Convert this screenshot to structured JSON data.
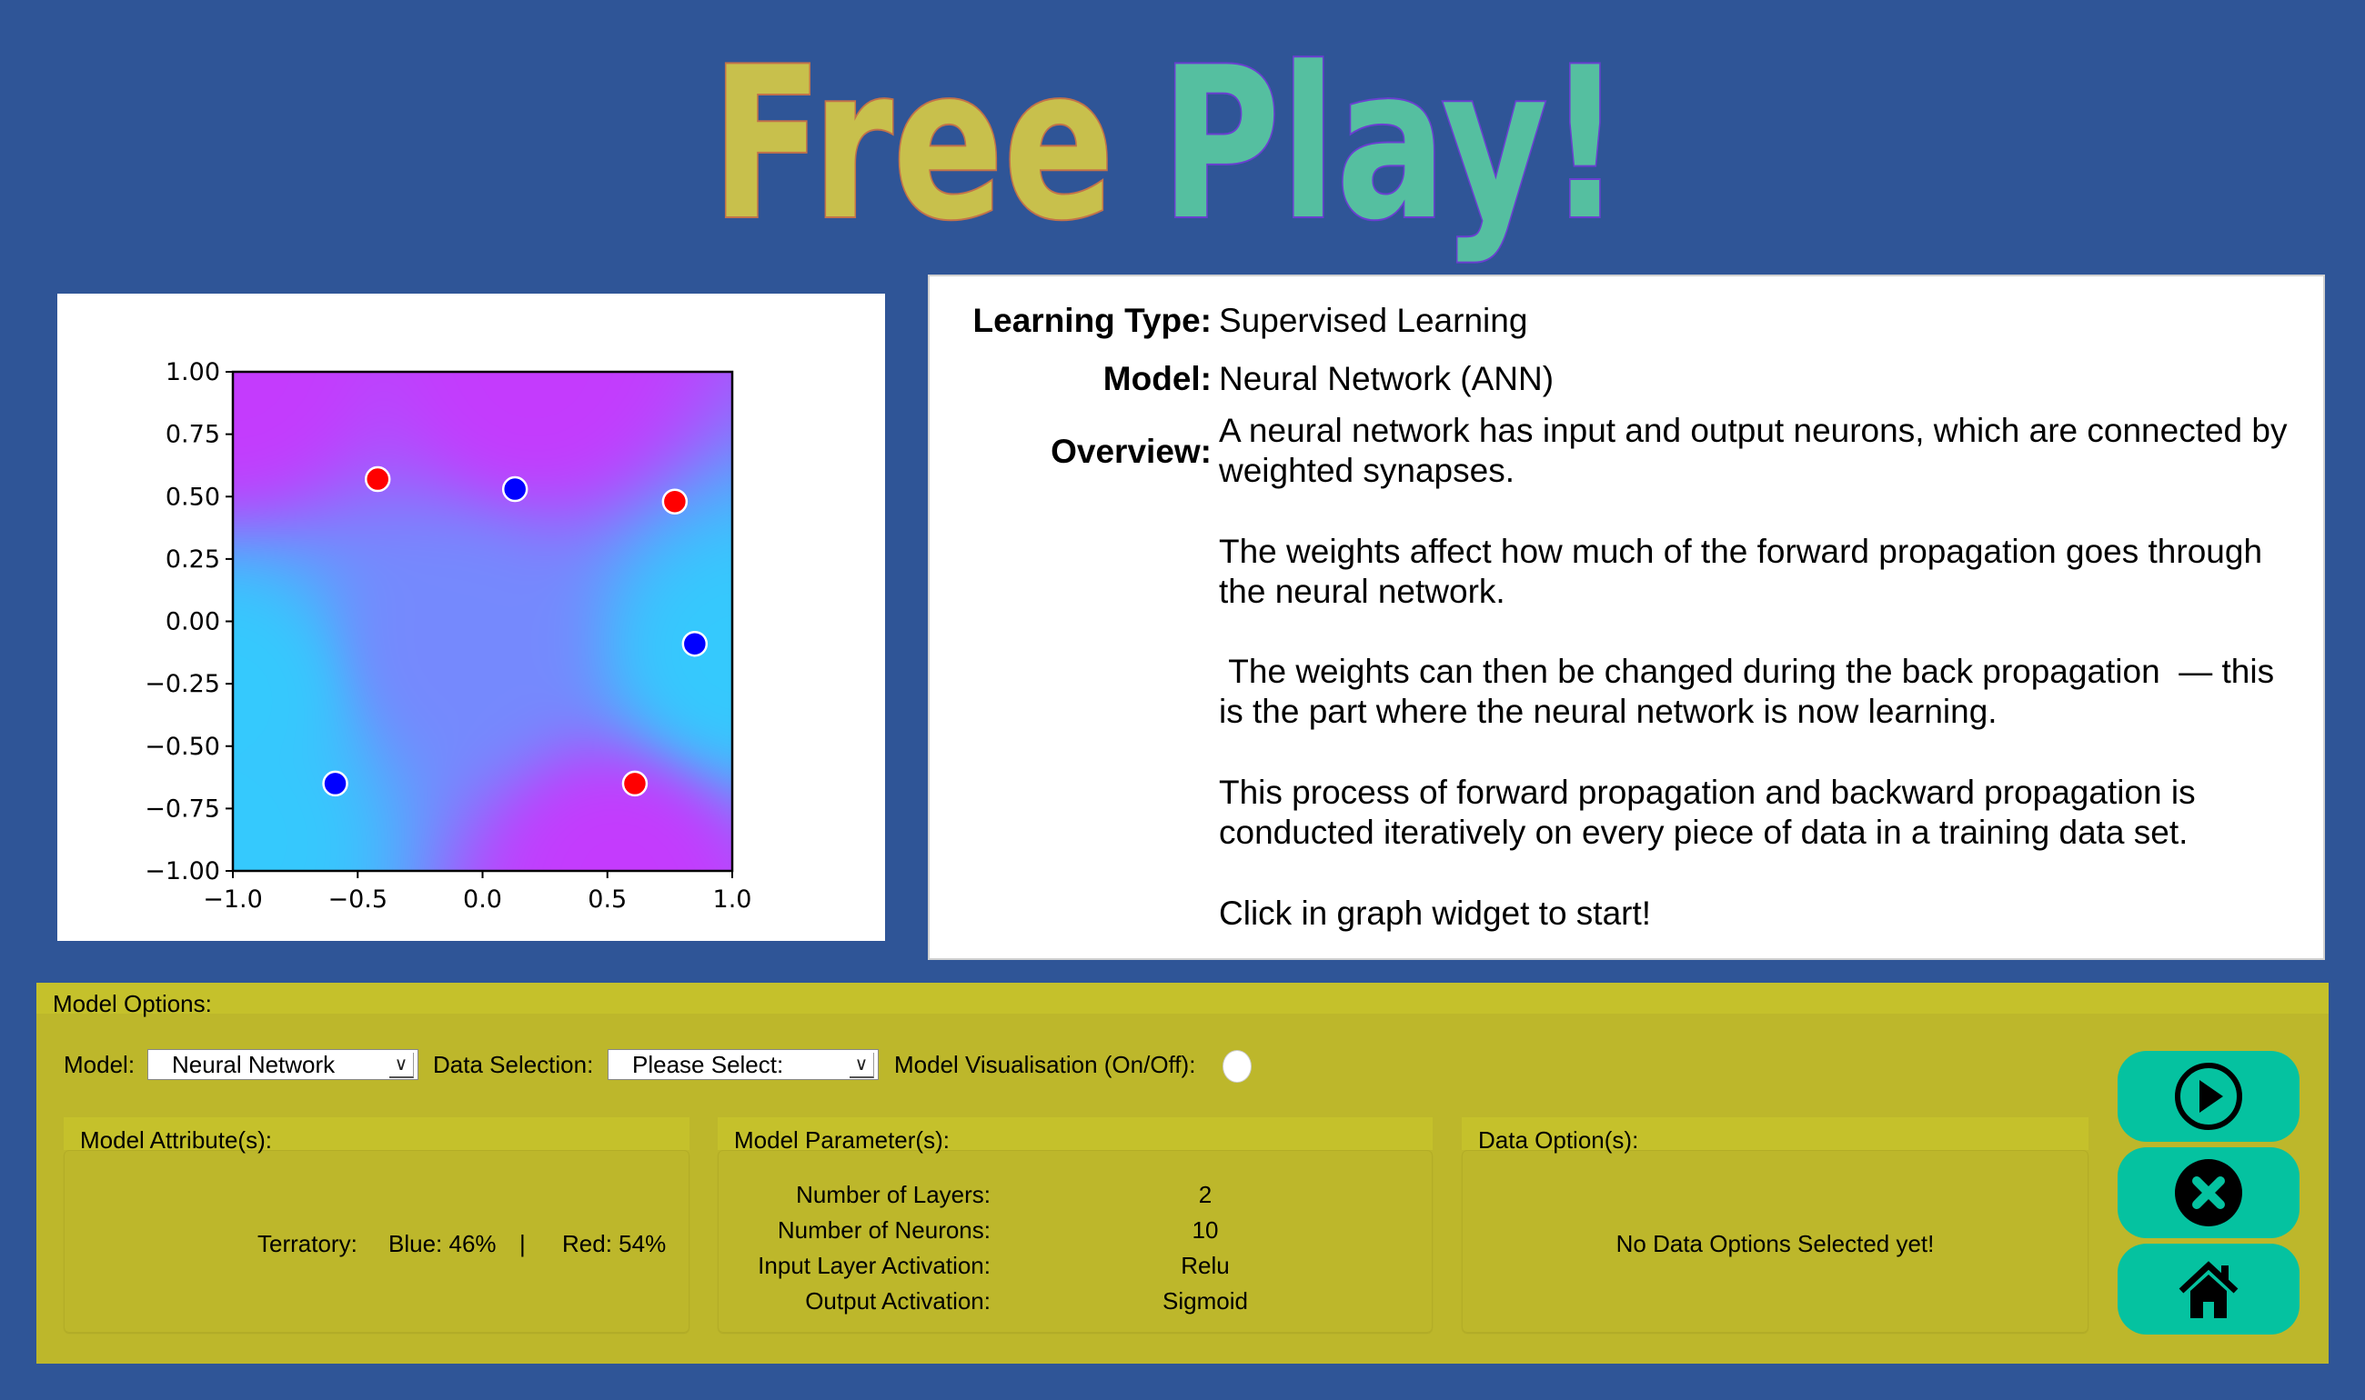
{
  "title": {
    "word1": "Free",
    "word2": "Play!",
    "word1_color": "#c8c04c",
    "word2_color": "#55bfa0"
  },
  "info": {
    "learning_type_label": "Learning Type:",
    "learning_type_value": "Supervised Learning",
    "model_label": "Model:",
    "model_value": "Neural Network (ANN)",
    "overview_label": "Overview:",
    "paragraphs": [
      "A neural network has input and output neurons, which are connected by weighted synapses.",
      "The weights affect how much of the forward propagation goes through the neural network.",
      " The weights can then be changed during the back propagation  — this is the part where the neural network is now learning.",
      "This process of forward propagation and backward propagation is conducted iteratively on every piece of data in a training data set.",
      "Click in graph widget to start!"
    ]
  },
  "options": {
    "section_label": "Model Options:",
    "model_label": "Model:",
    "model_value": "Neural Network",
    "data_label": "Data Selection:",
    "data_value": "Please Select:",
    "visualisation_label": "Model Visualisation (On/Off):",
    "visualisation_on": false,
    "attributes": {
      "title": "Model Attribute(s):",
      "territory_label": "Terratory:",
      "blue": "Blue: 46%",
      "separator": "|",
      "red": "Red: 54%"
    },
    "parameters": {
      "title": "Model Parameter(s):",
      "rows": [
        {
          "label": "Number of Layers:",
          "value": "2"
        },
        {
          "label": "Number of Neurons:",
          "value": "10"
        },
        {
          "label": "Input Layer Activation:",
          "value": "Relu"
        },
        {
          "label": "Output Activation:",
          "value": "Sigmoid"
        }
      ]
    },
    "data_options": {
      "title": "Data Option(s):",
      "empty_text": "No Data Options Selected yet!"
    }
  },
  "actions": [
    {
      "icon": "play-circle-icon"
    },
    {
      "icon": "close-circle-icon"
    },
    {
      "icon": "home-icon"
    }
  ],
  "colors": {
    "background": "#2f5597",
    "panel": "#bdb72b",
    "button": "#05c2a0",
    "region_blue": "#35c9fd",
    "region_red": "#c43bfd"
  },
  "chart_data": {
    "type": "scatter",
    "xlim": [
      -1.0,
      1.0
    ],
    "ylim": [
      -1.0,
      1.0
    ],
    "xticks": [
      "−1.0",
      "−0.5",
      "0.0",
      "0.5",
      "1.0"
    ],
    "yticks": [
      "1.00",
      "0.75",
      "0.50",
      "0.25",
      "0.00",
      "−0.25",
      "−0.50",
      "−0.75",
      "−1.00"
    ],
    "grid": false,
    "background": "decision-region gradient (blue/red classes)",
    "series": [
      {
        "color": "#ff0000",
        "points": [
          [
            -0.42,
            0.57
          ],
          [
            0.77,
            0.48
          ],
          [
            0.61,
            -0.65
          ]
        ]
      },
      {
        "color": "#0000ff",
        "points": [
          [
            0.13,
            0.53
          ],
          [
            0.85,
            -0.09
          ],
          [
            -0.59,
            -0.65
          ]
        ]
      }
    ]
  }
}
